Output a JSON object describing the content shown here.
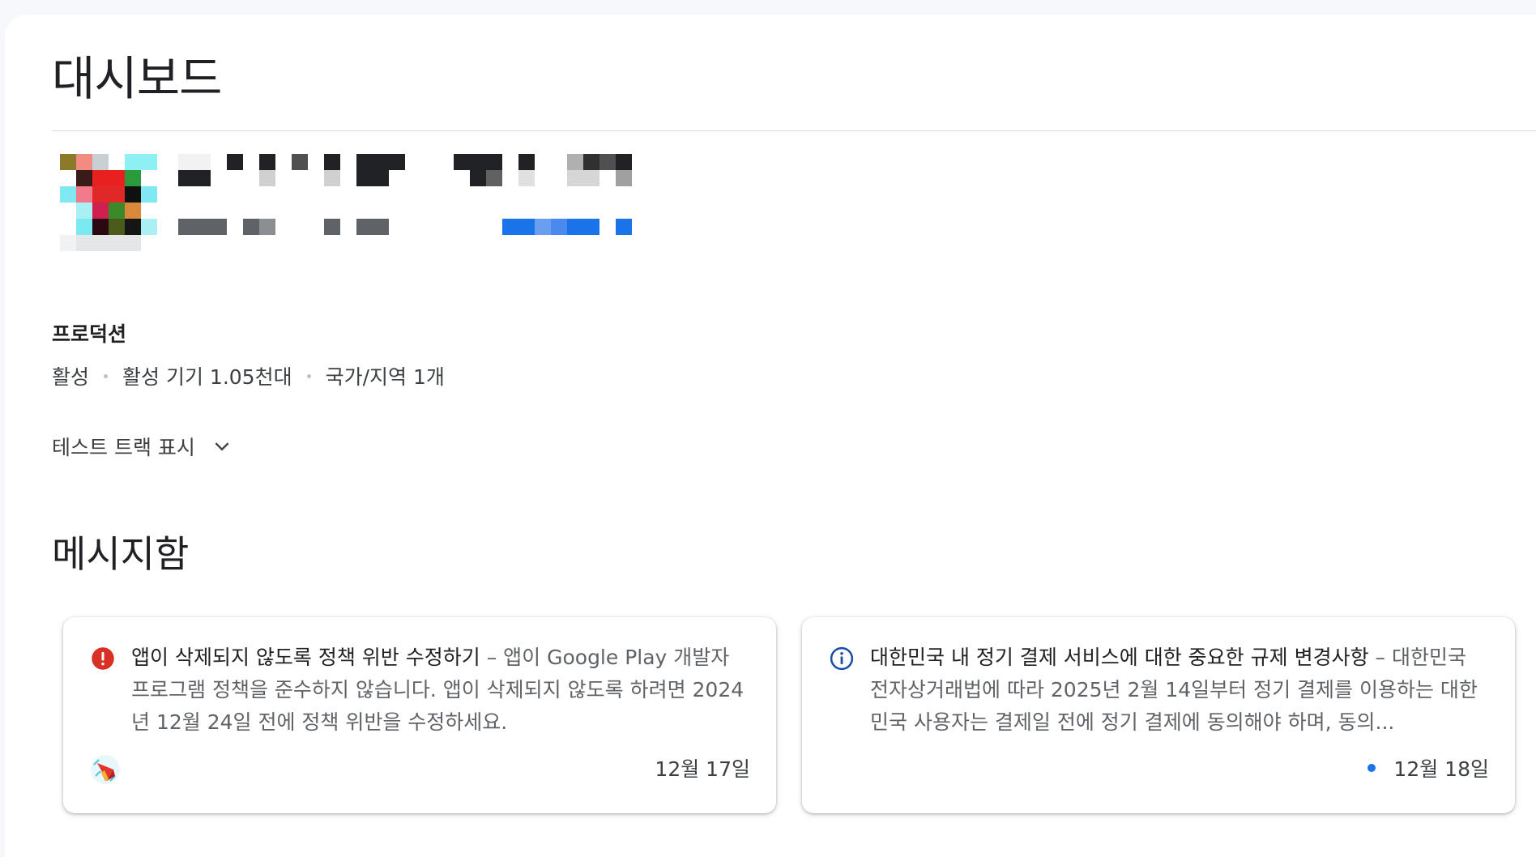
{
  "page": {
    "title": "대시보드"
  },
  "app": {
    "icon": "app-icon-redacted",
    "name_redacted": true
  },
  "release": {
    "track": "프로덕션",
    "status": "활성",
    "active_devices": "활성 기기 1.05천대",
    "countries": "국가/지역 1개",
    "show_test_tracks": "테스트 트랙 표시"
  },
  "inbox": {
    "title": "메시지함",
    "messages": [
      {
        "icon": "error-icon",
        "icon_color": "#d93025",
        "title": "앱이 삭제되지 않도록 정책 위반 수정하기",
        "separator": " – ",
        "body": "앱이 Google Play 개발자 프로그램 정책을 준수하지 않습니다. 앱이 삭제되지 않도록 하려면 2024년 12월 24일 전에 정책 위반을 수정하세요.",
        "date": "12월 17일",
        "unread": false,
        "thumbnail": "megaphone-icon"
      },
      {
        "icon": "info-icon",
        "icon_color": "#174ea6",
        "title": "대한민국 내 정기 결제 서비스에 대한 중요한 규제 변경사항",
        "separator": " – ",
        "body": "대한민국 전자상거래법에 따라 2025년 2월 14일부터 정기 결제를 이용하는 대한민국 사용자는 결제일 전에 정기 결제에 동의해야 하며, 동의...",
        "date": "12월 18일",
        "unread": true
      }
    ]
  },
  "colors": {
    "accent": "#1a73e8",
    "error": "#d93025",
    "text_primary": "#202124",
    "text_secondary": "#5f6368"
  }
}
